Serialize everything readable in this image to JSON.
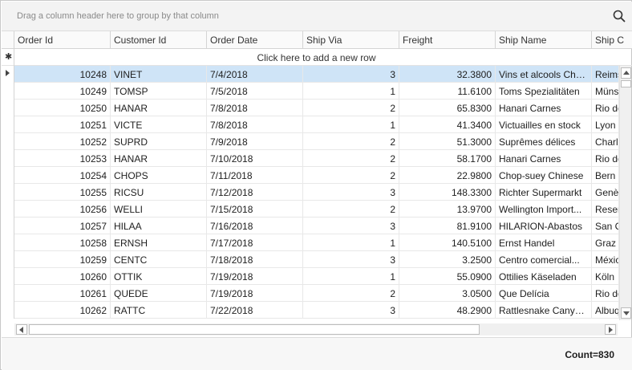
{
  "group_panel": {
    "hint": "Drag a column header here to group by that column"
  },
  "columns": [
    "Order Id",
    "Customer Id",
    "Order Date",
    "Ship Via",
    "Freight",
    "Ship Name",
    "Ship C"
  ],
  "new_row_text": "Click here to add a new row",
  "rows": [
    [
      "10248",
      "VINET",
      "7/4/2018",
      "3",
      "32.3800",
      "Vins et alcools Che...",
      "Reims"
    ],
    [
      "10249",
      "TOMSP",
      "7/5/2018",
      "1",
      "11.6100",
      "Toms Spezialitäten",
      "Münst"
    ],
    [
      "10250",
      "HANAR",
      "7/8/2018",
      "2",
      "65.8300",
      "Hanari Carnes",
      "Rio de"
    ],
    [
      "10251",
      "VICTE",
      "7/8/2018",
      "1",
      "41.3400",
      "Victuailles en stock",
      "Lyon"
    ],
    [
      "10252",
      "SUPRD",
      "7/9/2018",
      "2",
      "51.3000",
      "Suprêmes délices",
      "Charle"
    ],
    [
      "10253",
      "HANAR",
      "7/10/2018",
      "2",
      "58.1700",
      "Hanari Carnes",
      "Rio de"
    ],
    [
      "10254",
      "CHOPS",
      "7/11/2018",
      "2",
      "22.9800",
      "Chop-suey Chinese",
      "Bern"
    ],
    [
      "10255",
      "RICSU",
      "7/12/2018",
      "3",
      "148.3300",
      "Richter Supermarkt",
      "Genève"
    ],
    [
      "10256",
      "WELLI",
      "7/15/2018",
      "2",
      "13.9700",
      "Wellington Import...",
      "Resen"
    ],
    [
      "10257",
      "HILAA",
      "7/16/2018",
      "3",
      "81.9100",
      "HILARION-Abastos",
      "San C"
    ],
    [
      "10258",
      "ERNSH",
      "7/17/2018",
      "1",
      "140.5100",
      "Ernst Handel",
      "Graz"
    ],
    [
      "10259",
      "CENTC",
      "7/18/2018",
      "3",
      "3.2500",
      "Centro comercial...",
      "México"
    ],
    [
      "10260",
      "OTTIK",
      "7/19/2018",
      "1",
      "55.0900",
      "Ottilies Käseladen",
      "Köln"
    ],
    [
      "10261",
      "QUEDE",
      "7/19/2018",
      "2",
      "3.0500",
      "Que Delícia",
      "Rio de"
    ],
    [
      "10262",
      "RATTC",
      "7/22/2018",
      "3",
      "48.2900",
      "Rattlesnake Canyo...",
      "Albuq"
    ]
  ],
  "selected_row": 0,
  "footer": {
    "count_label": "Count=830"
  },
  "colors": {
    "selection": "#cfe4f7",
    "header_bg": "#fafafa",
    "panel_bg": "#f3f3f3"
  },
  "icons": {
    "search": "search-icon"
  }
}
